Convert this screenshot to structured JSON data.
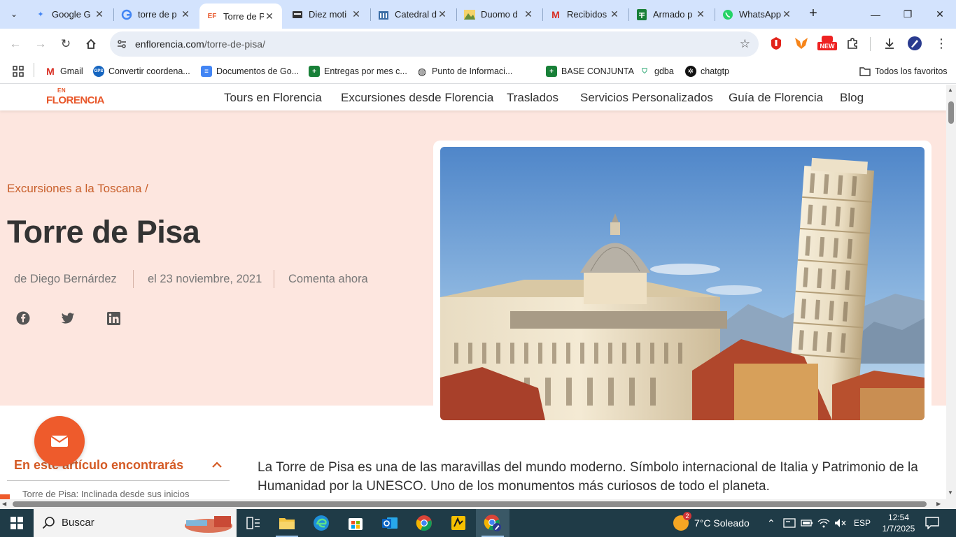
{
  "browser": {
    "tabs": [
      {
        "title": "Google G",
        "favicon": "gemini-icon",
        "active": false
      },
      {
        "title": "torre de p",
        "favicon": "google-icon",
        "active": false
      },
      {
        "title": "Torre de P",
        "favicon": "EF",
        "active": true
      },
      {
        "title": "Diez moti",
        "favicon": "site-icon",
        "active": false
      },
      {
        "title": "Catedral d",
        "favicon": "site-icon",
        "active": false
      },
      {
        "title": "Duomo d",
        "favicon": "site-icon",
        "active": false
      },
      {
        "title": "Recibidos",
        "favicon": "gmail-icon",
        "active": false
      },
      {
        "title": "Armado p",
        "favicon": "sheets-icon",
        "active": false
      },
      {
        "title": "WhatsApp",
        "favicon": "whatsapp-icon",
        "active": false
      }
    ],
    "url_domain": "enflorencia.com",
    "url_path": "/torre-de-pisa/",
    "bookmarks": [
      {
        "label": "Gmail"
      },
      {
        "label": "Convertir coordena..."
      },
      {
        "label": "Documentos de Go..."
      },
      {
        "label": "Entregas por mes c..."
      },
      {
        "label": "Punto de Informaci..."
      },
      {
        "label": "BASE CONJUNTA"
      },
      {
        "label": "gdba"
      },
      {
        "label": "chatgtp"
      }
    ],
    "all_bookmarks": "Todos los favoritos",
    "ext_badge": "NEW"
  },
  "site": {
    "logo_top": "EN",
    "logo_main": "FLORENCIA",
    "nav": [
      "Tours en Florencia",
      "Excursiones desde Florencia",
      "Traslados",
      "Servicios Personalizados",
      "Guía de Florencia",
      "Blog"
    ],
    "breadcrumb": "Excursiones a la Toscana /",
    "title": "Torre de Pisa",
    "author": "de Diego Bernárdez",
    "date": "el 23 noviembre, 2021",
    "comment": "Comenta ahora",
    "toc_title": "En este artículo encontrarás",
    "toc_first": "Torre de Pisa: Inclinada desde sus inicios",
    "article_text": "La Torre de Pisa es una de las maravillas del mundo moderno. Símbolo internacional de Italia y Patrimonio de la Humanidad por la UNESCO. Uno de los monumentos más curiosos de todo el planeta."
  },
  "taskbar": {
    "search_label": "Buscar",
    "weather": "7°C Soleado",
    "weather_badge": "2",
    "lang": "ESP",
    "time": "12:54",
    "date": "1/7/2025"
  },
  "colors": {
    "accent": "#ee5b2c",
    "hero_bg": "#fde6df",
    "tabstrip": "#d3e3fd",
    "taskbar": "#1f3b47"
  }
}
